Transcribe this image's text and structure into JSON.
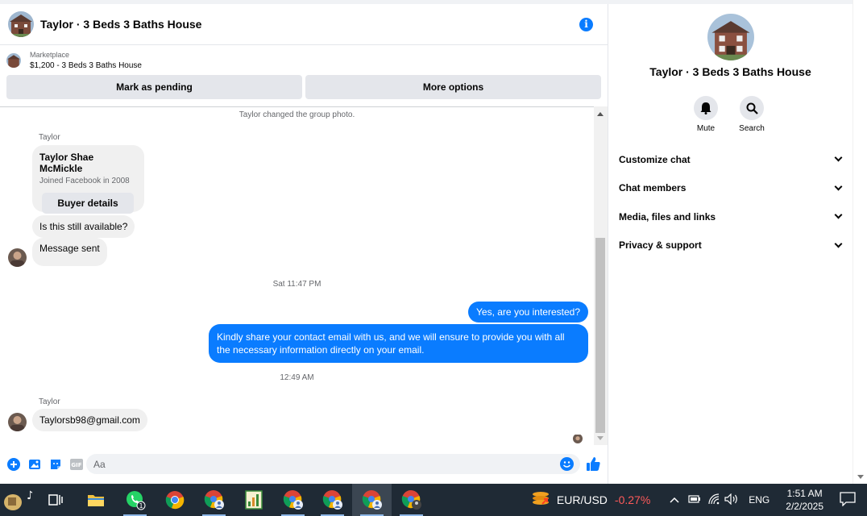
{
  "header": {
    "title": "Taylor · 3 Beds 3 Baths House"
  },
  "marketplace": {
    "label": "Marketplace",
    "listing": "$1,200 - 3 Beds 3 Baths House"
  },
  "actions": {
    "mark_pending": "Mark as pending",
    "more_options": "More options"
  },
  "messages": {
    "system_group_photo": "Taylor changed the group photo.",
    "sender_1": "Taylor",
    "card": {
      "name": "Taylor Shae McMickle",
      "joined": "Joined Facebook in 2008",
      "button": "Buyer details"
    },
    "in_1": "Is this still available?",
    "in_2": "Message sent",
    "time_1": "Sat 11:47 PM",
    "out_1": "Yes, are you interested?",
    "out_2": "Kindly share your contact email with us, and we will ensure to provide you with all the necessary information directly on your email.",
    "time_2": "12:49 AM",
    "sender_2": "Taylor",
    "in_3": "Taylorsb98@gmail.com"
  },
  "composer": {
    "placeholder": "Aa",
    "gif_label": "GIF"
  },
  "sidebar": {
    "title": "Taylor · 3 Beds 3 Baths House",
    "mute": "Mute",
    "search": "Search",
    "menu": [
      "Customize chat",
      "Chat members",
      "Media, files and links",
      "Privacy & support"
    ]
  },
  "taskbar": {
    "currency_pair": "EUR/USD",
    "currency_change": "-0.27%",
    "whatsapp_badge": "1",
    "language": "ENG",
    "time": "1:51 AM",
    "date": "2/2/2025"
  },
  "colors": {
    "accent": "#0a7cff",
    "negative": "#ff5a5a",
    "taskbar": "#1f2a35"
  }
}
